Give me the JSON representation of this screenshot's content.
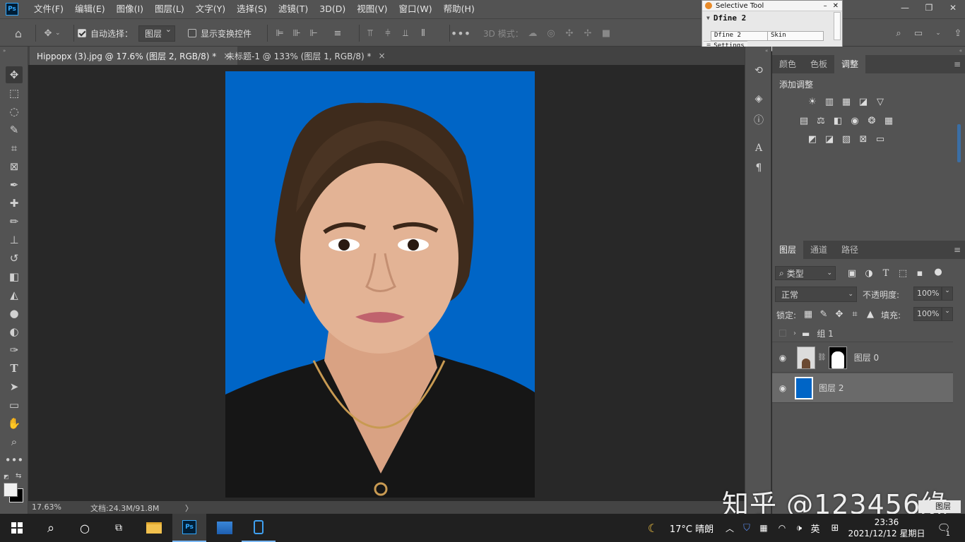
{
  "app_logo": "Ps",
  "menu": [
    "文件(F)",
    "编辑(E)",
    "图像(I)",
    "图层(L)",
    "文字(Y)",
    "选择(S)",
    "滤镜(T)",
    "3D(D)",
    "视图(V)",
    "窗口(W)",
    "帮助(H)"
  ],
  "options": {
    "auto_select_label": "自动选择：",
    "auto_select_value": "图层",
    "show_transform_label": "显示变换控件",
    "mode_3d_label": "3D 模式："
  },
  "tabs": [
    {
      "label": "Hippopx (3).jpg @ 17.6% (图层 2, RGB/8) *",
      "close": "×"
    },
    {
      "label": "未标题-1 @ 133% (图层 1, RGB/8) *",
      "close": "×"
    }
  ],
  "status": {
    "zoom": "17.63%",
    "doc": "文档:24.3M/91.8M",
    "arrow": "〉"
  },
  "selective_tool": {
    "title": "Selective Tool",
    "heading": "Dfine 2",
    "tab1": "Dfine 2",
    "tab2": "Skin",
    "settings": "Settings"
  },
  "adjust_panel": {
    "tabs": [
      "颜色",
      "色板",
      "调整"
    ],
    "active": 2,
    "title": "添加调整"
  },
  "layers_panel": {
    "tabs": [
      "图层",
      "通道",
      "路径"
    ],
    "filter_value": "类型",
    "blend_mode": "正常",
    "opacity_label": "不透明度:",
    "opacity_value": "100%",
    "lock_label": "锁定:",
    "fill_label": "填充:",
    "fill_value": "100%",
    "layers": [
      {
        "name": "组 1",
        "type": "group",
        "visible": false
      },
      {
        "name": "图层 0",
        "type": "masked",
        "visible": true
      },
      {
        "name": "图层 2",
        "type": "fill",
        "visible": true,
        "selected": true
      }
    ]
  },
  "taskbar": {
    "weather": "17°C 晴朗",
    "ime": "英",
    "time": "23:36",
    "date": "2021/12/12 星期日",
    "notif": "1"
  },
  "watermark": "知乎 @123456缘",
  "watermark_tail": "图层",
  "colors": {
    "canvas_blue": "#0065c6",
    "panel": "#535353",
    "ps_blue": "#31a8ff"
  }
}
